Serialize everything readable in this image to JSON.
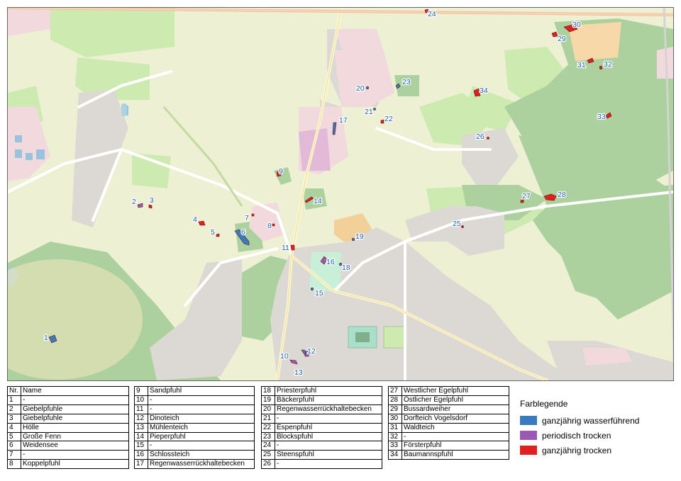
{
  "legend": {
    "title": "Farblegende",
    "items": [
      {
        "label": "ganzjährig wasserführend",
        "color": "#3a7bbf"
      },
      {
        "label": "periodisch trocken",
        "color": "#9b59b6"
      },
      {
        "label": "ganzjährig trocken",
        "color": "#e02020"
      }
    ]
  },
  "table": {
    "header": {
      "nr": "Nr.",
      "name": "Name"
    },
    "rows": [
      {
        "nr": "1",
        "name": "-"
      },
      {
        "nr": "2",
        "name": "Giebelpfuhle"
      },
      {
        "nr": "3",
        "name": "Giebelpfuhle"
      },
      {
        "nr": "4",
        "name": "Hölle"
      },
      {
        "nr": "5",
        "name": "Große Fenn"
      },
      {
        "nr": "6",
        "name": "Weidensee"
      },
      {
        "nr": "7",
        "name": "-"
      },
      {
        "nr": "8",
        "name": "Koppelpfuhl"
      },
      {
        "nr": "9",
        "name": "Sandpfuhl"
      },
      {
        "nr": "10",
        "name": "-"
      },
      {
        "nr": "11",
        "name": "-"
      },
      {
        "nr": "12",
        "name": "Dinoteich"
      },
      {
        "nr": "13",
        "name": "Mühlenteich"
      },
      {
        "nr": "14",
        "name": "Pieperpfuhl"
      },
      {
        "nr": "15",
        "name": "-"
      },
      {
        "nr": "16",
        "name": "Schlossteich"
      },
      {
        "nr": "17",
        "name": "Regenwasserrückhaltebecken"
      },
      {
        "nr": "18",
        "name": "Priesterpfuhl"
      },
      {
        "nr": "19",
        "name": "Bäckerpfuhl"
      },
      {
        "nr": "20",
        "name": "Regenwasserrückhaltebecken"
      },
      {
        "nr": "21",
        "name": "-"
      },
      {
        "nr": "22",
        "name": "Espenpfuhl"
      },
      {
        "nr": "23",
        "name": "Blockspfuhl"
      },
      {
        "nr": "24",
        "name": "-"
      },
      {
        "nr": "25",
        "name": "Steenspfuhl"
      },
      {
        "nr": "26",
        "name": "-"
      },
      {
        "nr": "27",
        "name": "Westlicher Egelpfuhl"
      },
      {
        "nr": "28",
        "name": "Östlicher Egelpfuhl"
      },
      {
        "nr": "29",
        "name": "Bussardweiher"
      },
      {
        "nr": "30",
        "name": "Dorfteich Vogelsdorf"
      },
      {
        "nr": "31",
        "name": "Waldteich"
      },
      {
        "nr": "32",
        "name": "-"
      },
      {
        "nr": "33",
        "name": "Försterpfuhl"
      },
      {
        "nr": "34",
        "name": "Baumannspfuhl"
      }
    ]
  },
  "map": {
    "ponds": [
      {
        "nr": "1",
        "status": "ganzjährig wasserführend"
      },
      {
        "nr": "2",
        "status": "periodisch trocken"
      },
      {
        "nr": "3",
        "status": "ganzjährig trocken"
      },
      {
        "nr": "4",
        "status": "ganzjährig trocken"
      },
      {
        "nr": "5",
        "status": "ganzjährig trocken"
      },
      {
        "nr": "6",
        "status": "ganzjährig wasserführend"
      },
      {
        "nr": "7",
        "status": "ganzjährig trocken"
      },
      {
        "nr": "8",
        "status": "ganzjährig trocken"
      },
      {
        "nr": "9",
        "status": "ganzjährig trocken"
      },
      {
        "nr": "10",
        "status": "periodisch trocken"
      },
      {
        "nr": "11",
        "status": "ganzjährig trocken"
      },
      {
        "nr": "12",
        "status": "ganzjährig wasserführend"
      },
      {
        "nr": "13",
        "status": "periodisch trocken"
      },
      {
        "nr": "14",
        "status": "ganzjährig trocken"
      },
      {
        "nr": "15",
        "status": "ganzjährig wasserführend"
      },
      {
        "nr": "16",
        "status": "periodisch trocken"
      },
      {
        "nr": "17",
        "status": "ganzjährig wasserführend"
      },
      {
        "nr": "18",
        "status": "ganzjährig wasserführend"
      },
      {
        "nr": "19",
        "status": "ganzjährig wasserführend"
      },
      {
        "nr": "20",
        "status": "ganzjährig wasserführend"
      },
      {
        "nr": "21",
        "status": "ganzjährig wasserführend"
      },
      {
        "nr": "22",
        "status": "ganzjährig trocken"
      },
      {
        "nr": "23",
        "status": "ganzjährig wasserführend"
      },
      {
        "nr": "24",
        "status": "ganzjährig trocken"
      },
      {
        "nr": "25",
        "status": "ganzjährig trocken"
      },
      {
        "nr": "26",
        "status": "ganzjährig trocken"
      },
      {
        "nr": "27",
        "status": "ganzjährig trocken"
      },
      {
        "nr": "28",
        "status": "ganzjährig trocken"
      },
      {
        "nr": "29",
        "status": "ganzjährig trocken"
      },
      {
        "nr": "30",
        "status": "ganzjährig trocken"
      },
      {
        "nr": "31",
        "status": "ganzjährig trocken"
      },
      {
        "nr": "32",
        "status": "ganzjährig trocken"
      },
      {
        "nr": "33",
        "status": "ganzjährig trocken"
      },
      {
        "nr": "34",
        "status": "ganzjährig trocken"
      }
    ]
  }
}
